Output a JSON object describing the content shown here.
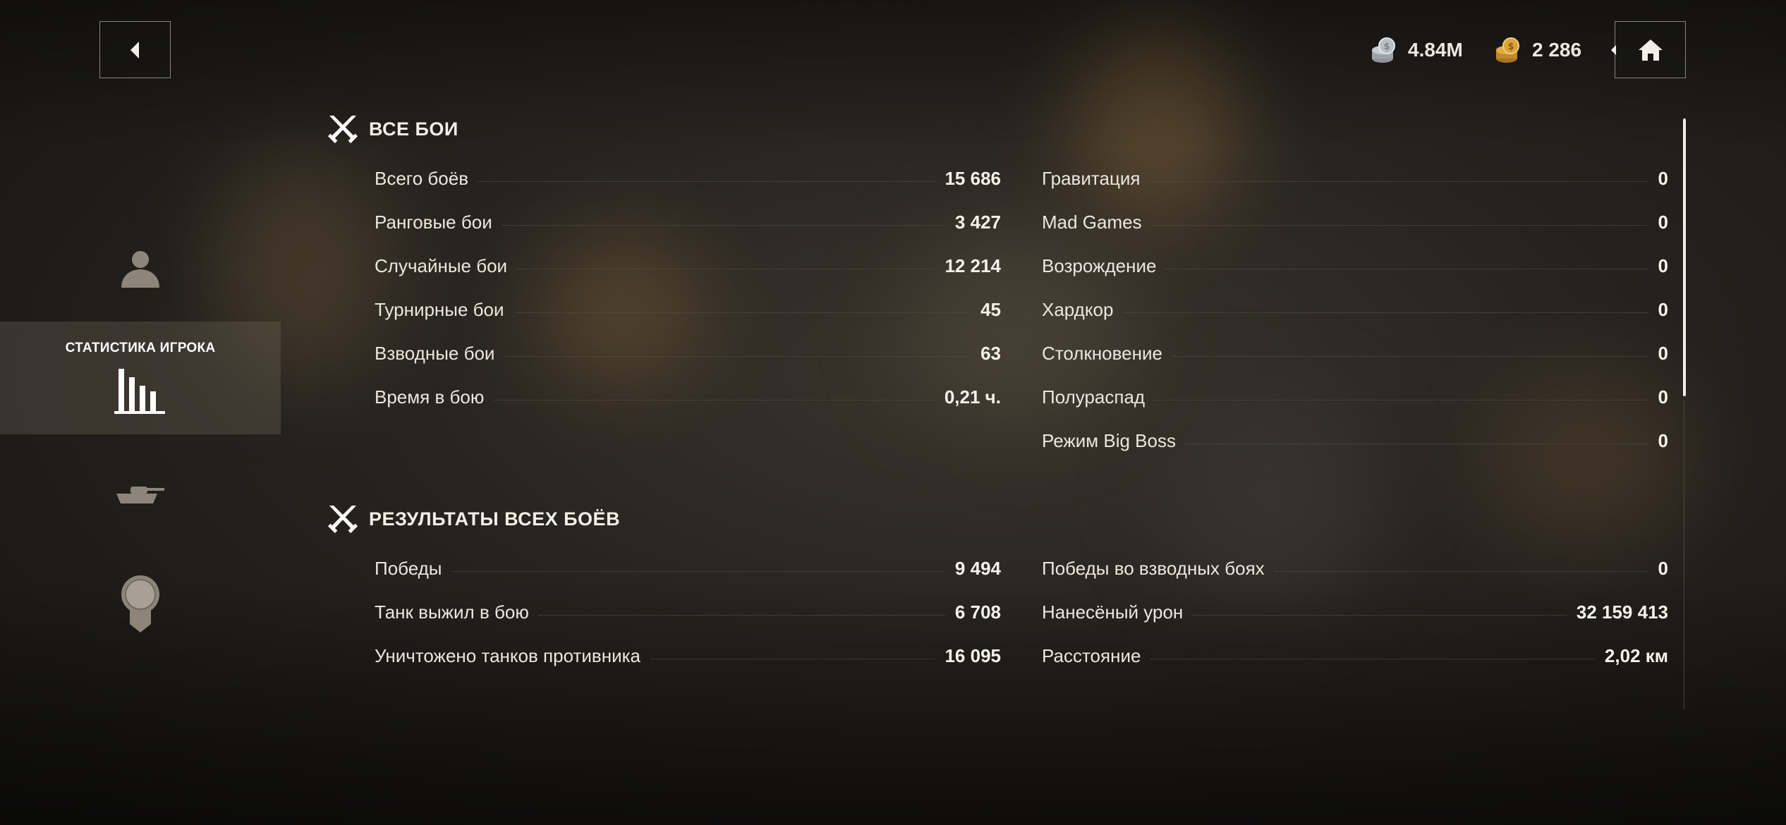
{
  "currency": {
    "silver": {
      "icon": "silver-coins-icon",
      "value": "4.84M"
    },
    "gold": {
      "icon": "gold-coins-icon",
      "value": "2 286"
    }
  },
  "sidebar": {
    "items": [
      {
        "icon": "profile-icon",
        "label": ""
      },
      {
        "icon": "stats-bars-icon",
        "label": "СТАТИСТИКА ИГРОКА",
        "active": true
      },
      {
        "icon": "tank-icon",
        "label": ""
      },
      {
        "icon": "medal-icon",
        "label": ""
      }
    ]
  },
  "sections": [
    {
      "title": "ВСЕ БОИ",
      "icon": "crossed-swords-icon",
      "left": [
        {
          "label": "Всего боёв",
          "value": "15 686"
        },
        {
          "label": "Ранговые бои",
          "value": "3 427"
        },
        {
          "label": "Случайные бои",
          "value": "12 214"
        },
        {
          "label": "Турнирные бои",
          "value": "45"
        },
        {
          "label": "Взводные бои",
          "value": "63"
        },
        {
          "label": "Время в бою",
          "value": "0,21 ч."
        }
      ],
      "right": [
        {
          "label": "Гравитация",
          "value": "0"
        },
        {
          "label": "Mad Games",
          "value": "0"
        },
        {
          "label": "Возрождение",
          "value": "0"
        },
        {
          "label": "Хардкор",
          "value": "0"
        },
        {
          "label": "Столкновение",
          "value": "0"
        },
        {
          "label": "Полураспад",
          "value": "0"
        },
        {
          "label": "Режим Big Boss",
          "value": "0"
        }
      ]
    },
    {
      "title": "РЕЗУЛЬТАТЫ ВСЕХ БОЁВ",
      "icon": "crossed-swords-icon",
      "left": [
        {
          "label": "Победы",
          "value": "9 494"
        },
        {
          "label": "Танк выжил в бою",
          "value": "6 708"
        },
        {
          "label": "Уничтожено танков противника",
          "value": "16 095"
        }
      ],
      "right": [
        {
          "label": "Победы во взводных боях",
          "value": "0"
        },
        {
          "label": "Нанесёный урон",
          "value": "32 159 413"
        },
        {
          "label": "Расстояние",
          "value": "2,02 км"
        }
      ]
    }
  ],
  "colors": {
    "accent_text": "#f6f2ea",
    "active_bg": "#6e6456",
    "coin_gold": "#d9a33a",
    "coin_silver": "#b9bec4"
  }
}
